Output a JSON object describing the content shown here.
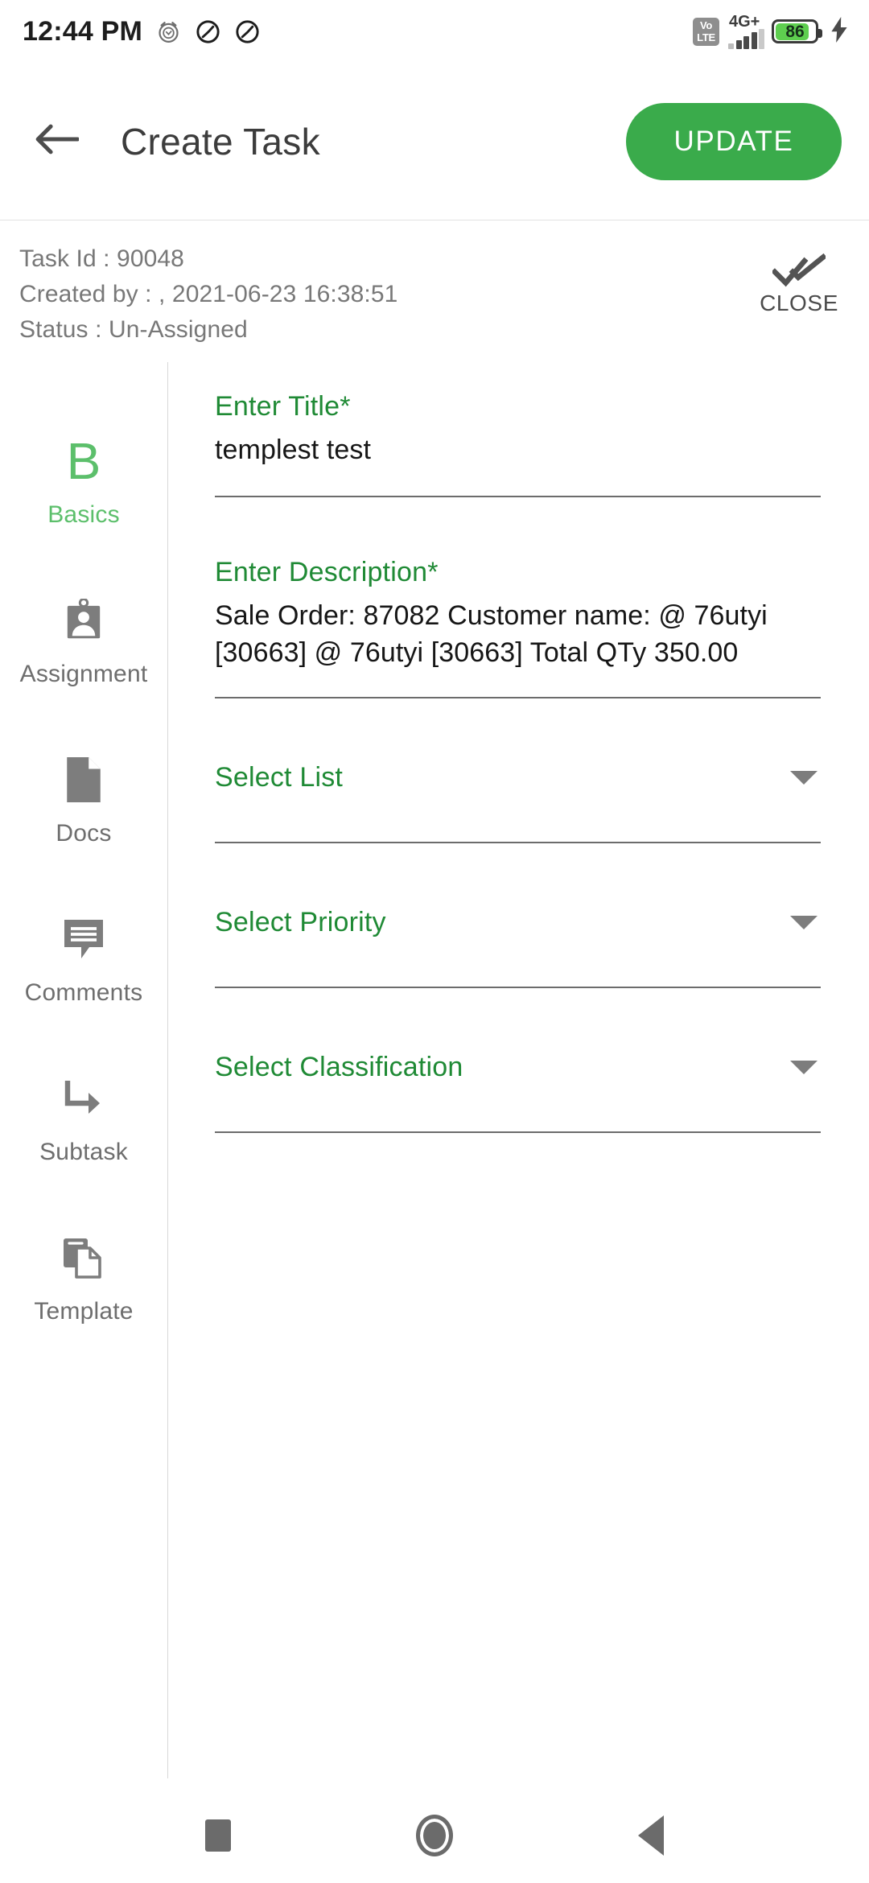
{
  "statusbar": {
    "time": "12:44 PM",
    "alarm_icon": "alarm-clock-icon",
    "dnd_icon_1": "do-not-disturb-icon",
    "dnd_icon_2": "do-not-disturb-icon",
    "volte_line1": "Vo",
    "volte_line2": "LTE",
    "network_label": "4G+",
    "battery_percent": "86",
    "charging_icon": "charging-bolt-icon"
  },
  "appbar": {
    "back_icon": "back-arrow-icon",
    "title": "Create Task",
    "update_label": "UPDATE"
  },
  "meta": {
    "task_id_line": "Task Id : 90048",
    "created_by_line": "Created by : , 2021-06-23 16:38:51",
    "status_line": "Status : Un-Assigned",
    "close_label": "CLOSE",
    "close_icon": "double-check-icon"
  },
  "sidebar": {
    "items": [
      {
        "label": "Basics",
        "icon": "letter-b-icon",
        "glyph": "B",
        "active": true
      },
      {
        "label": "Assignment",
        "icon": "id-badge-icon",
        "active": false
      },
      {
        "label": "Docs",
        "icon": "document-icon",
        "active": false
      },
      {
        "label": "Comments",
        "icon": "comment-bubble-icon",
        "active": false
      },
      {
        "label": "Subtask",
        "icon": "subtask-arrow-icon",
        "active": false
      },
      {
        "label": "Template",
        "icon": "copy-document-icon",
        "active": false
      }
    ]
  },
  "form": {
    "title_field": {
      "label": "Enter Title",
      "required_mark": "*",
      "value": "templest test"
    },
    "description_field": {
      "label": "Enter Description",
      "required_mark": "*",
      "value": "Sale Order: 87082 Customer name: @ 76utyi [30663] @ 76utyi [30663]  Total QTy 350.00"
    },
    "selects": [
      {
        "label": "Select List",
        "caret_icon": "chevron-down-icon"
      },
      {
        "label": "Select Priority",
        "caret_icon": "chevron-down-icon"
      },
      {
        "label": "Select Classification",
        "caret_icon": "chevron-down-icon"
      }
    ]
  },
  "navbar": {
    "recents_icon": "recents-square-icon",
    "home_icon": "home-circle-icon",
    "back_icon": "back-triangle-icon"
  },
  "colors": {
    "accent_green": "#3aab4b",
    "label_green": "#1f8a35",
    "active_tab_green": "#5cbf6b",
    "battery_green": "#5ece4f",
    "text_dark": "#161616",
    "text_muted": "#787878"
  }
}
